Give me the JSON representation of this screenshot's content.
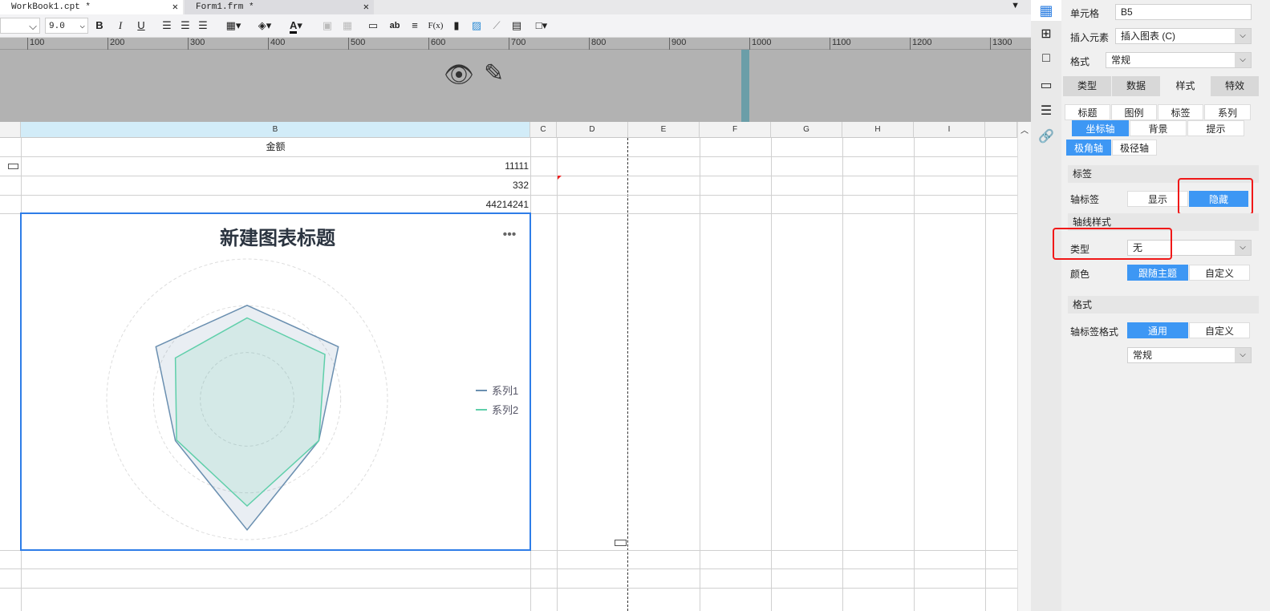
{
  "tabs": [
    {
      "label": "WorkBook1.cpt *"
    },
    {
      "label": "Form1.frm *"
    }
  ],
  "toolbar": {
    "font_size": "9.0",
    "bold": "B",
    "italic": "I",
    "underline": "U",
    "text_color": "A",
    "ab": "ab",
    "formula": "F(x)"
  },
  "ruler": [
    "100",
    "200",
    "300",
    "400",
    "500",
    "600",
    "700",
    "800",
    "900",
    "1000",
    "1100",
    "1200",
    "1300"
  ],
  "columns": [
    "B",
    "C",
    "D",
    "E",
    "F",
    "G",
    "H",
    "I"
  ],
  "cells": {
    "header": "金额",
    "r1": "11111",
    "r2": "332",
    "r3": "44214241"
  },
  "chart_data": {
    "type": "radar",
    "title": "新建图表标题",
    "series": [
      {
        "name": "系列1",
        "values": [
          67,
          75,
          59,
          93,
          59,
          75
        ],
        "color": "#6a8fb0"
      },
      {
        "name": "系列2",
        "values": [
          58,
          64,
          59,
          76,
          58,
          59
        ],
        "color": "#5fcfaa"
      }
    ],
    "axis_labels_visible": false,
    "legend": "right"
  },
  "panel": {
    "cell_label": "单元格",
    "cell_value": "B5",
    "insert_label": "插入元素",
    "insert_value": "插入图表 (C)",
    "format_label": "格式",
    "format_value": "常规",
    "tabs": [
      "类型",
      "数据",
      "样式",
      "特效"
    ],
    "subtabs1": [
      "标题",
      "图例",
      "标签",
      "系列"
    ],
    "subtabs2": [
      "坐标轴",
      "背景",
      "提示"
    ],
    "axis_tabs": [
      "极角轴",
      "极径轴"
    ],
    "sec_label": "标签",
    "axis_label": "轴标签",
    "show": "显示",
    "hide": "隐藏",
    "sec_line": "轴线样式",
    "type_label": "类型",
    "type_value": "无",
    "color_label": "颜色",
    "follow_theme": "跟随主题",
    "custom": "自定义",
    "sec_format": "格式",
    "axis_fmt_label": "轴标签格式",
    "general": "通用",
    "custom2": "自定义",
    "fmt_value": "常规"
  }
}
